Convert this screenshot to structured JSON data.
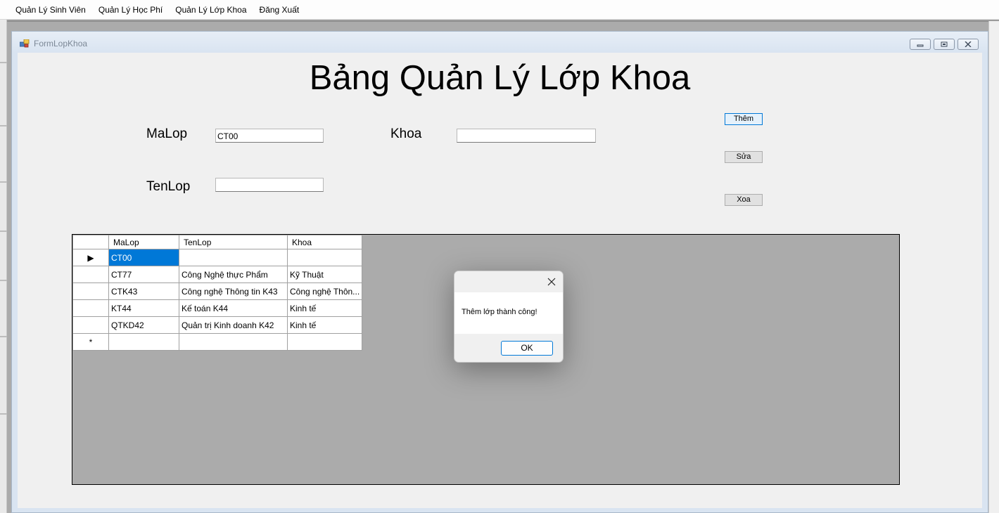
{
  "menubar": {
    "items": [
      "Quản Lý Sinh Viên",
      "Quản Lý Học Phí",
      "Quản Lý Lớp Khoa",
      "Đăng Xuất"
    ]
  },
  "form": {
    "title": "FormLopKhoa",
    "caption_buttons": {
      "minimize": "▭",
      "maximize": "▣",
      "close": "✕"
    },
    "heading": "Bảng Quản Lý Lớp Khoa",
    "labels": {
      "malop": "MaLop",
      "khoa": "Khoa",
      "tenlop": "TenLop"
    },
    "fields": {
      "malop_value": "CT00",
      "khoa_value": "",
      "tenlop_value": ""
    },
    "buttons": {
      "add": "Thêm",
      "edit": "Sửa",
      "delete": "Xoa"
    }
  },
  "grid": {
    "columns": [
      "MaLop",
      "TenLop",
      "Khoa"
    ],
    "rows": [
      {
        "indicator": "▶",
        "malop": "CT00",
        "tenlop": "",
        "khoa": ""
      },
      {
        "indicator": "",
        "malop": "CT77",
        "tenlop": "Công Nghệ thực Phẩm",
        "khoa": "Kỹ Thuật"
      },
      {
        "indicator": "",
        "malop": "CTK43",
        "tenlop": "Công nghệ Thông tin K43",
        "khoa": "Công nghệ Thôn..."
      },
      {
        "indicator": "",
        "malop": "KT44",
        "tenlop": "Kế toán K44",
        "khoa": "Kinh tế"
      },
      {
        "indicator": "",
        "malop": "QTKD42",
        "tenlop": "Quản trị Kinh doanh K42",
        "khoa": "Kinh tế"
      }
    ],
    "new_row_indicator": "*"
  },
  "messagebox": {
    "message": "Thêm lớp thành công!",
    "ok_label": "OK",
    "close_glyph": "✕"
  },
  "colors": {
    "selection": "#0078d7",
    "mdi_background": "#ababab"
  }
}
